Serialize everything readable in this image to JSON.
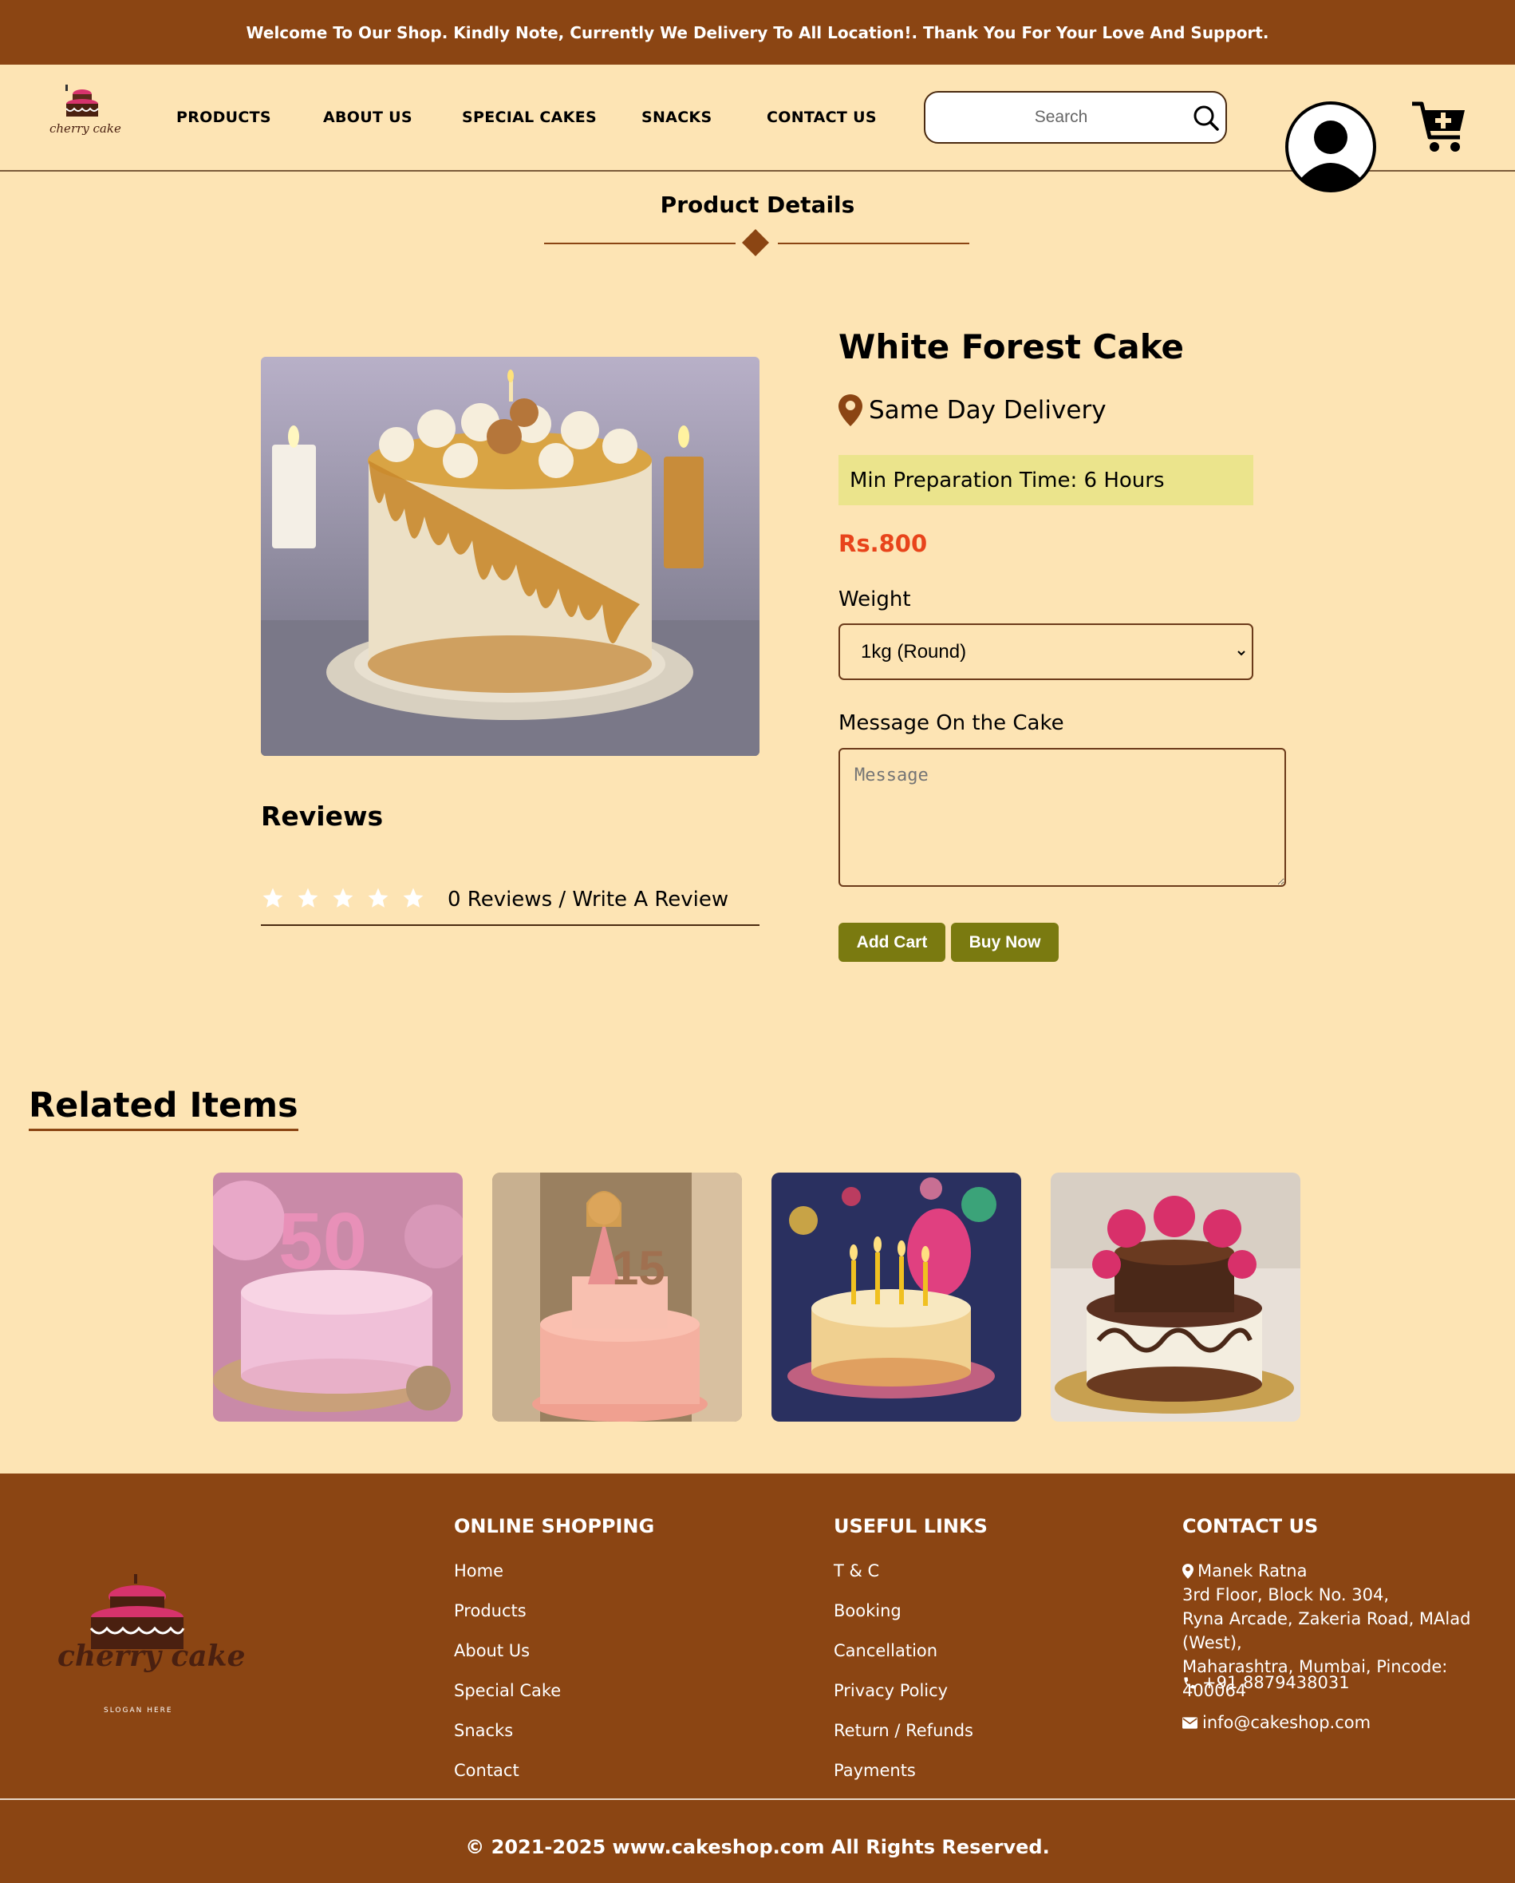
{
  "banner": {
    "text": "Welcome To Our Shop. Kindly Note, Currently We Delivery To All Location!. Thank You For Your Love And Support."
  },
  "header": {
    "logo_text": "cherry cake",
    "nav": [
      "PRODUCTS",
      "ABOUT US",
      "SPECIAL CAKES",
      "SNACKS",
      "CONTACT US"
    ],
    "search_placeholder": "Search"
  },
  "page_title": "Product Details",
  "product": {
    "name": "White Forest Cake",
    "delivery": "Same Day Delivery",
    "prep_time": "Min Preparation Time: 6 Hours",
    "price": "Rs.800",
    "weight_label": "Weight",
    "weight_value": "1kg (Round)",
    "message_label": "Message On the Cake",
    "message_placeholder": "Message",
    "add_cart": "Add Cart",
    "buy_now": "Buy Now"
  },
  "reviews": {
    "title": "Reviews",
    "rating": 0,
    "max_rating": 5,
    "summary": "0 Reviews / Write A Review"
  },
  "related": {
    "title": "Related Items",
    "items": [
      "pink-50-cake",
      "doll-cake",
      "birthday-candles-cake",
      "anniversary-rose-cake"
    ]
  },
  "footer": {
    "logo_text": "cherry cake",
    "logo_slogan": "SLOGAN HERE",
    "online_shopping": {
      "title": "ONLINE SHOPPING",
      "links": [
        "Home",
        "Products",
        "About Us",
        "Special Cake",
        "Snacks",
        "Contact"
      ]
    },
    "useful_links": {
      "title": "USEFUL LINKS",
      "links": [
        "T & C",
        "Booking",
        "Cancellation",
        "Privacy Policy",
        "Return / Refunds",
        "Payments"
      ]
    },
    "contact": {
      "title": "CONTACT US",
      "address": [
        "Manek Ratna",
        "3rd Floor, Block No. 304,",
        "Ryna Arcade, Zakeria Road, MAlad (West),",
        "Maharashtra, Mumbai, Pincode: 400064"
      ],
      "phone": "+91 8879438031",
      "email": "info@cakeshop.com"
    },
    "copyright": "© 2021-2025 www.cakeshop.com All Rights Reserved."
  },
  "colors": {
    "brown": "#8b4513",
    "cream": "#fde4b4",
    "olive": "#7a7a10",
    "price": "#e8441b",
    "highlight": "#ebe48c"
  }
}
